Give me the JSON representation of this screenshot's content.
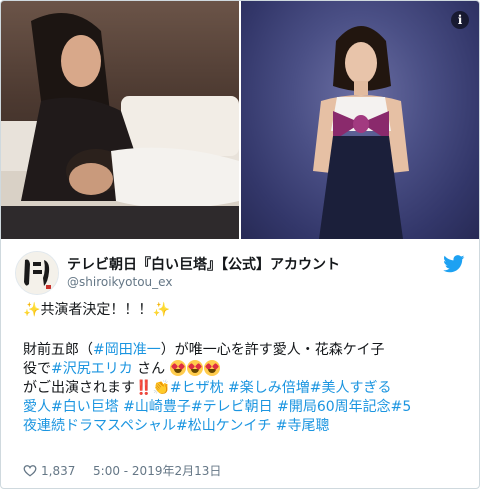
{
  "media": {
    "info_glyph": "i"
  },
  "account": {
    "display_name": "テレビ朝日『白い巨塔』【公式】アカウント",
    "handle": "@shiroikyotou_ex",
    "avatar_text": "白い巨塔"
  },
  "tweet": {
    "headline": "共演者決定！！！",
    "line1_pre": "財前五郎（",
    "line1_tag": "#岡田准一",
    "line1_post": "）が唯一心を許す愛人・花森ケイ子",
    "line2_pre": "役で",
    "line2_tag": "#沢尻エリカ",
    "line2_post": " さん",
    "line3_pre": "がご出演されます",
    "line3_bang": "‼️",
    "line3_tags": "#ヒザ枕 #楽しみ倍増#美人すぎる",
    "line4_tags": "愛人#白い巨塔 #山崎豊子#テレビ朝日 #開局60周年記念#5",
    "line5_tags": "夜連続ドラマスペシャル#松山ケンイチ #寺尾聰"
  },
  "footer": {
    "likes": "1,837",
    "timestamp": "5:00 - 2019年2月13日"
  },
  "colors": {
    "link": "#1b95e0",
    "twitter_blue": "#1da1f2",
    "text": "#14171a",
    "muted": "#657786"
  },
  "icons": [
    "info-icon",
    "twitter-bird-icon",
    "heart-icon",
    "sparkles-icon",
    "heart-eyes-emoji",
    "clapping-hands-emoji"
  ]
}
